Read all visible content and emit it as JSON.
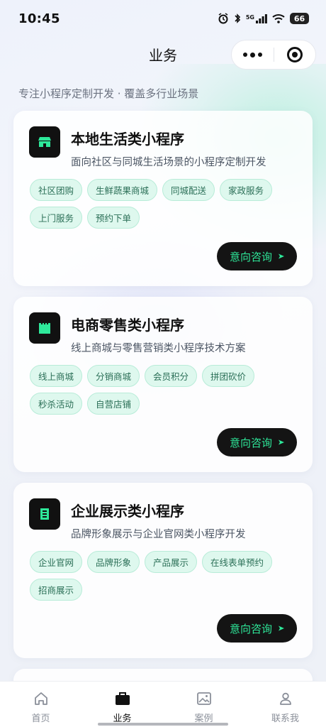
{
  "status_bar": {
    "time": "10:45",
    "battery": "66",
    "network": "5G"
  },
  "header": {
    "title": "业务"
  },
  "subtitle": "专注小程序定制开发 · 覆盖多行业场景",
  "cards": [
    {
      "title": "本地生活类小程序",
      "desc": "面向社区与同城生活场景的小程序定制开发",
      "icon": "shop-icon",
      "tags": [
        "社区团购",
        "生鲜蔬果商城",
        "同城配送",
        "家政服务",
        "上门服务",
        "预约下单"
      ],
      "button": "意向咨询"
    },
    {
      "title": "电商零售类小程序",
      "desc": "线上商城与零售营销类小程序技术方案",
      "icon": "store-icon",
      "tags": [
        "线上商城",
        "分销商城",
        "会员积分",
        "拼团砍价",
        "秒杀活动",
        "自营店铺"
      ],
      "button": "意向咨询"
    },
    {
      "title": "企业展示类小程序",
      "desc": "品牌形象展示与企业官网类小程序开发",
      "icon": "document-icon",
      "tags": [
        "企业官网",
        "品牌形象",
        "产品展示",
        "在线表单预约",
        "招商展示"
      ],
      "button": "意向咨询"
    }
  ],
  "tabs": [
    {
      "label": "首页",
      "icon": "home-icon",
      "active": false
    },
    {
      "label": "业务",
      "icon": "briefcase-icon",
      "active": true
    },
    {
      "label": "案例",
      "icon": "gallery-icon",
      "active": false
    },
    {
      "label": "联系我",
      "icon": "person-icon",
      "active": false
    }
  ],
  "colors": {
    "accent": "#2ee89a",
    "tag_bg": "#def8ee",
    "tag_text": "#2b6f57",
    "dark": "#141414"
  }
}
